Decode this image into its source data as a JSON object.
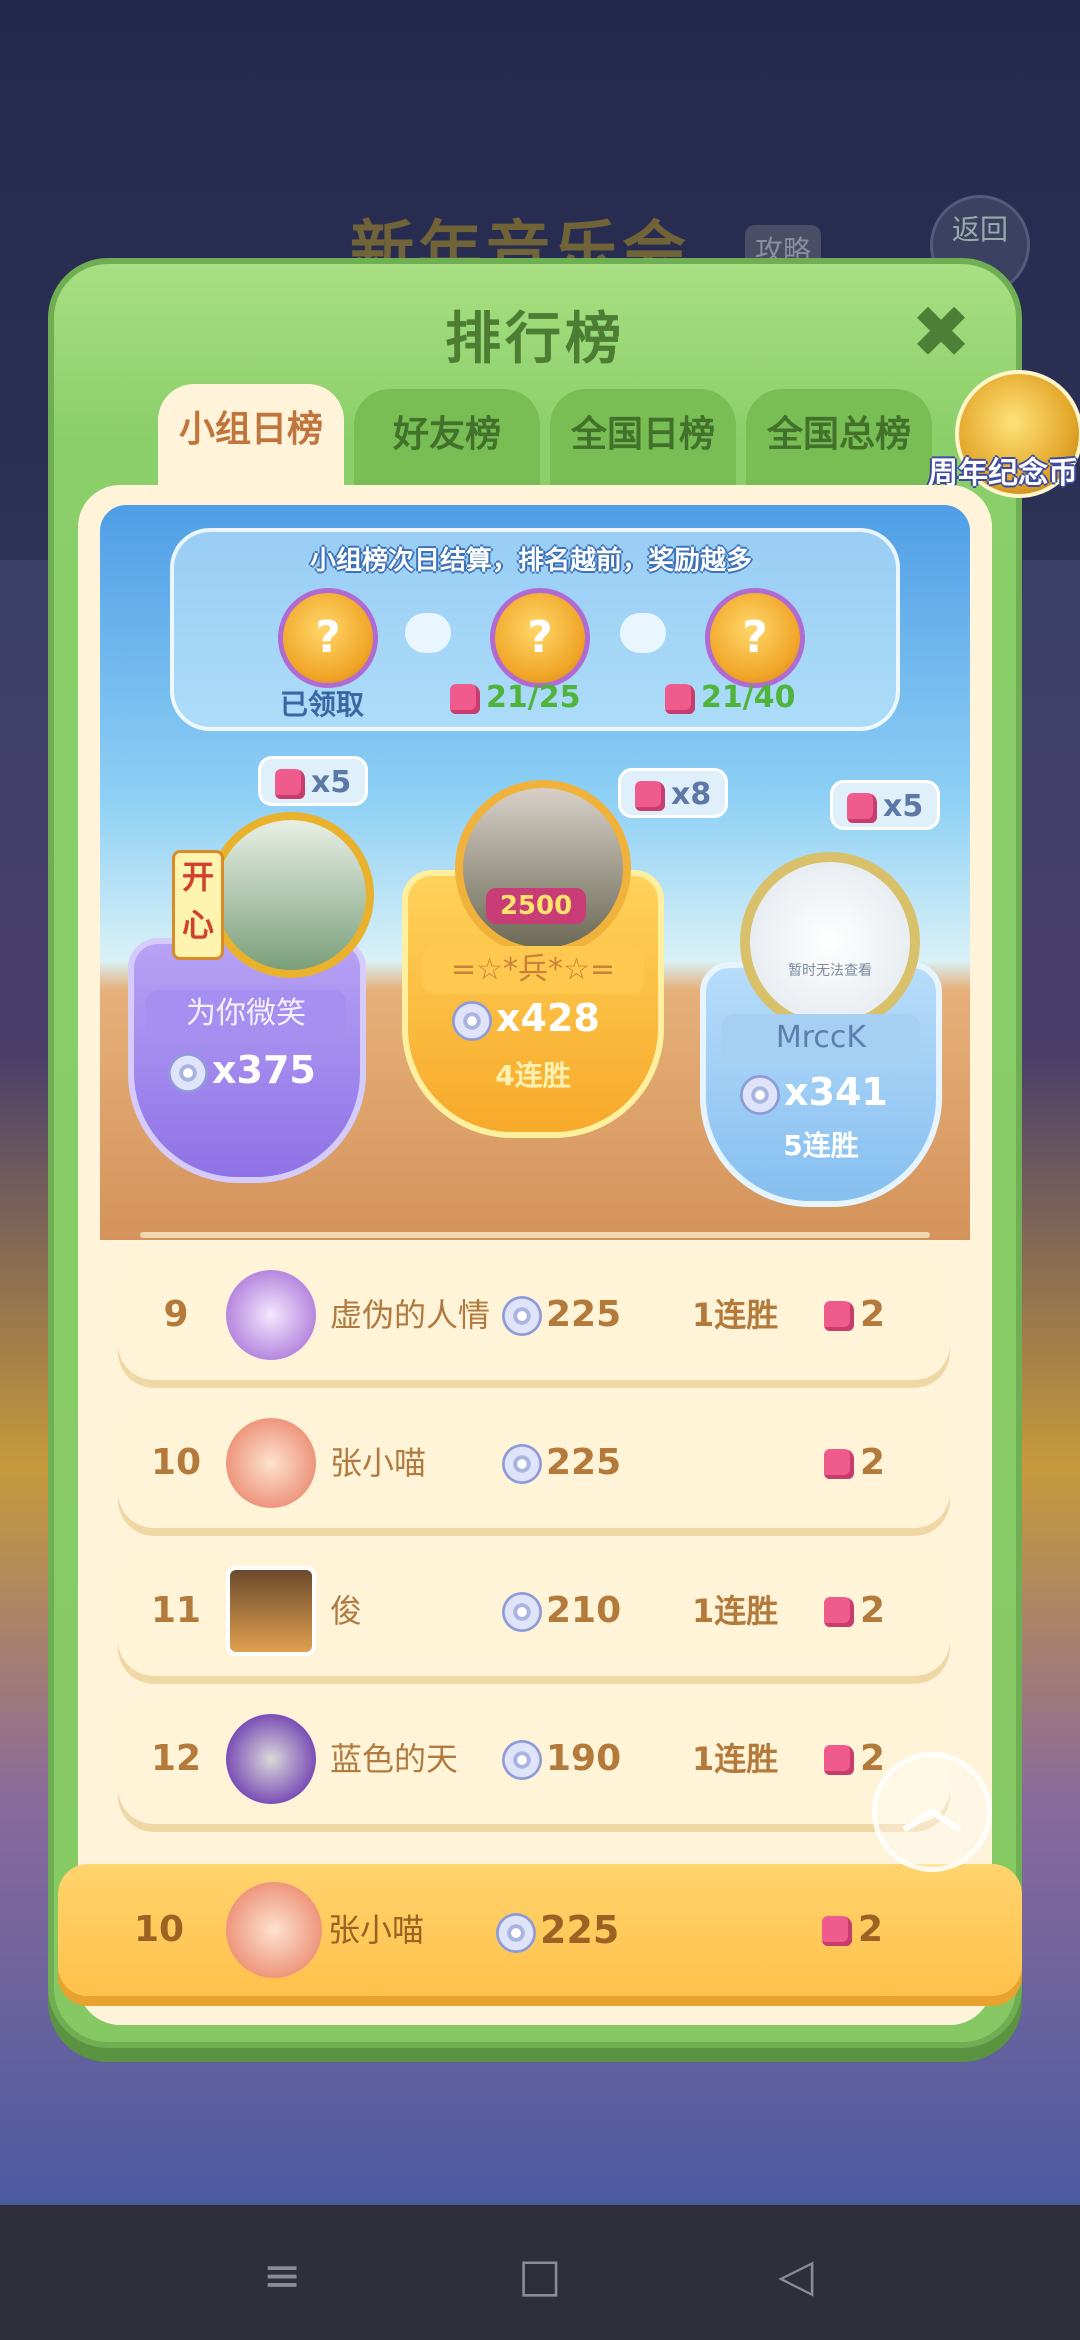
{
  "background": {
    "title": "新年音乐会",
    "tag": "攻略",
    "return_label": "返回"
  },
  "panel": {
    "title": "排行榜",
    "close_icon": "close-icon",
    "tabs": [
      {
        "label": "小组日榜",
        "active": true
      },
      {
        "label": "好友榜",
        "active": false
      },
      {
        "label": "全国日榜",
        "active": false
      },
      {
        "label": "全国总榜",
        "active": false
      }
    ],
    "side_coin_label": "周年纪念币"
  },
  "rewards": {
    "notice": "小组榜次日结算，排名越前，奖励越多",
    "items": [
      {
        "status": "已领取"
      },
      {
        "progress": "21/25"
      },
      {
        "progress": "21/40"
      }
    ]
  },
  "podium": {
    "first": {
      "name": "=☆*兵*☆=",
      "score": "x428",
      "streak": "4连胜",
      "bubble": "x8",
      "frame_value": "2500"
    },
    "second": {
      "name": "为你微笑",
      "score": "x375",
      "bubble": "x5",
      "badge": "开心"
    },
    "third": {
      "name": "MrccK",
      "score": "x341",
      "streak": "5连胜",
      "bubble": "x5",
      "avatar_text": "暂时无法查看"
    }
  },
  "rows": [
    {
      "rank": "9",
      "name": "虚伪的人情",
      "score": "225",
      "streak": "1连胜",
      "pieces": "2"
    },
    {
      "rank": "10",
      "name": "张小喵",
      "score": "225",
      "streak": "",
      "pieces": "2"
    },
    {
      "rank": "11",
      "name": "俊",
      "score": "210",
      "streak": "1连胜",
      "pieces": "2"
    },
    {
      "rank": "12",
      "name": "蓝色的天",
      "score": "190",
      "streak": "1连胜",
      "pieces": "2"
    }
  ],
  "mine": {
    "rank": "10",
    "name": "张小喵",
    "score": "225",
    "pieces": "2"
  },
  "colors": {
    "panel_green": "#8acf69",
    "accent_orange": "#ffc14b",
    "text_brown": "#b37a3c"
  }
}
